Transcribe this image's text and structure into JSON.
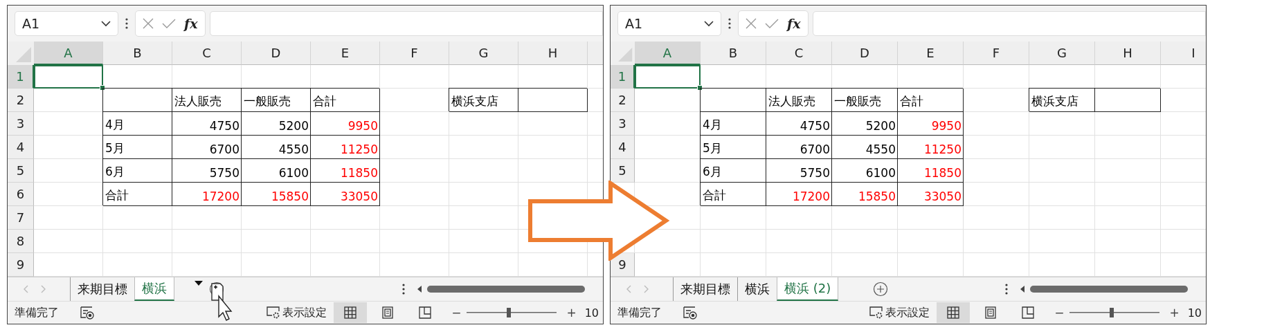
{
  "windows": [
    {
      "name_box": "A1",
      "fx_label": "fx",
      "drag_copy": true,
      "columns": [
        {
          "label": "A",
          "selected": true
        },
        {
          "label": "B",
          "selected": false
        },
        {
          "label": "C",
          "selected": false
        },
        {
          "label": "D",
          "selected": false
        },
        {
          "label": "E",
          "selected": false
        },
        {
          "label": "F",
          "selected": false
        },
        {
          "label": "G",
          "selected": false
        },
        {
          "label": "H",
          "selected": false
        }
      ],
      "rows": [
        {
          "label": "1",
          "selected": true
        },
        {
          "label": "2",
          "selected": false,
          "cells": [
            {
              "kind": "empty"
            },
            {
              "kind": "border"
            },
            {
              "kind": "text",
              "text": "法人販売"
            },
            {
              "kind": "text",
              "text": "一般販売"
            },
            {
              "kind": "text",
              "text": "合計"
            },
            {
              "kind": "empty"
            },
            {
              "kind": "text",
              "text": "横浜支店"
            },
            {
              "kind": "border"
            }
          ]
        },
        {
          "label": "3",
          "selected": false,
          "cells": [
            {
              "kind": "empty"
            },
            {
              "kind": "text",
              "text": "4月"
            },
            {
              "kind": "number",
              "text": "4750",
              "color": "#000000"
            },
            {
              "kind": "number",
              "text": "5200",
              "color": "#000000"
            },
            {
              "kind": "number",
              "text": "9950",
              "color": "#ff0000"
            }
          ]
        },
        {
          "label": "4",
          "selected": false,
          "cells": [
            {
              "kind": "empty"
            },
            {
              "kind": "text",
              "text": "5月"
            },
            {
              "kind": "number",
              "text": "6700",
              "color": "#000000"
            },
            {
              "kind": "number",
              "text": "4550",
              "color": "#000000"
            },
            {
              "kind": "number",
              "text": "11250",
              "color": "#ff0000"
            }
          ]
        },
        {
          "label": "5",
          "selected": false,
          "cells": [
            {
              "kind": "empty"
            },
            {
              "kind": "text",
              "text": "6月"
            },
            {
              "kind": "number",
              "text": "5750",
              "color": "#000000"
            },
            {
              "kind": "number",
              "text": "6100",
              "color": "#000000"
            },
            {
              "kind": "number",
              "text": "11850",
              "color": "#ff0000"
            }
          ]
        },
        {
          "label": "6",
          "selected": false,
          "cells": [
            {
              "kind": "empty"
            },
            {
              "kind": "text",
              "text": "合計"
            },
            {
              "kind": "number",
              "text": "17200",
              "color": "#ff0000"
            },
            {
              "kind": "number",
              "text": "15850",
              "color": "#ff0000"
            },
            {
              "kind": "number",
              "text": "33050",
              "color": "#ff0000"
            }
          ]
        },
        {
          "label": "7",
          "selected": false
        },
        {
          "label": "8",
          "selected": false
        },
        {
          "label": "9",
          "selected": false
        }
      ],
      "sheet_tabs": [
        {
          "label": "来期目標",
          "selected": false
        },
        {
          "label": "横浜",
          "selected": true
        }
      ],
      "status": "準備完了",
      "display_settings": "表示設定",
      "views": [
        {
          "selected": true
        },
        {
          "selected": false
        },
        {
          "selected": false
        }
      ],
      "zoom": {
        "minus": "−",
        "plus": "+",
        "level": 0.47,
        "reading": "10"
      }
    },
    {
      "name_box": "A1",
      "fx_label": "fx",
      "columns": [
        {
          "label": "A",
          "selected": true
        },
        {
          "label": "B",
          "selected": false
        },
        {
          "label": "C",
          "selected": false
        },
        {
          "label": "D",
          "selected": false
        },
        {
          "label": "E",
          "selected": false
        },
        {
          "label": "F",
          "selected": false
        },
        {
          "label": "G",
          "selected": false
        },
        {
          "label": "H",
          "selected": false
        },
        {
          "label": "I",
          "selected": false
        }
      ],
      "rows": [
        {
          "label": "1",
          "selected": true
        },
        {
          "label": "2",
          "selected": false,
          "cells": [
            {
              "kind": "empty"
            },
            {
              "kind": "border"
            },
            {
              "kind": "text",
              "text": "法人販売"
            },
            {
              "kind": "text",
              "text": "一般販売"
            },
            {
              "kind": "text",
              "text": "合計"
            },
            {
              "kind": "empty"
            },
            {
              "kind": "text",
              "text": "横浜支店"
            },
            {
              "kind": "border"
            }
          ]
        },
        {
          "label": "3",
          "selected": false,
          "cells": [
            {
              "kind": "empty"
            },
            {
              "kind": "text",
              "text": "4月"
            },
            {
              "kind": "number",
              "text": "4750",
              "color": "#000000"
            },
            {
              "kind": "number",
              "text": "5200",
              "color": "#000000"
            },
            {
              "kind": "number",
              "text": "9950",
              "color": "#ff0000"
            }
          ]
        },
        {
          "label": "4",
          "selected": false,
          "cells": [
            {
              "kind": "empty"
            },
            {
              "kind": "text",
              "text": "5月"
            },
            {
              "kind": "number",
              "text": "6700",
              "color": "#000000"
            },
            {
              "kind": "number",
              "text": "4550",
              "color": "#000000"
            },
            {
              "kind": "number",
              "text": "11250",
              "color": "#ff0000"
            }
          ]
        },
        {
          "label": "5",
          "selected": false,
          "cells": [
            {
              "kind": "empty"
            },
            {
              "kind": "text",
              "text": "6月"
            },
            {
              "kind": "number",
              "text": "5750",
              "color": "#000000"
            },
            {
              "kind": "number",
              "text": "6100",
              "color": "#000000"
            },
            {
              "kind": "number",
              "text": "11850",
              "color": "#ff0000"
            }
          ]
        },
        {
          "cells": [
            {
              "kind": "empty"
            },
            {
              "kind": "text",
              "text": "合計"
            },
            {
              "kind": "number",
              "text": "17200",
              "color": "#ff0000"
            },
            {
              "kind": "number",
              "text": "15850",
              "color": "#ff0000"
            },
            {
              "kind": "number",
              "text": "33050",
              "color": "#ff0000"
            }
          ]
        },
        {},
        {},
        {
          "label": "9",
          "selected": false
        }
      ],
      "sheet_tabs": [
        {
          "label": "来期目標",
          "selected": false
        },
        {
          "label": "横浜",
          "selected": false
        },
        {
          "label": "横浜 (2)",
          "selected": true
        }
      ],
      "status": "準備完了",
      "display_settings": "表示設定",
      "views": [
        {
          "selected": true
        },
        {
          "selected": false
        },
        {
          "selected": false
        }
      ],
      "zoom": {
        "minus": "−",
        "plus": "+",
        "level": 0.47,
        "reading": "10"
      }
    }
  ]
}
